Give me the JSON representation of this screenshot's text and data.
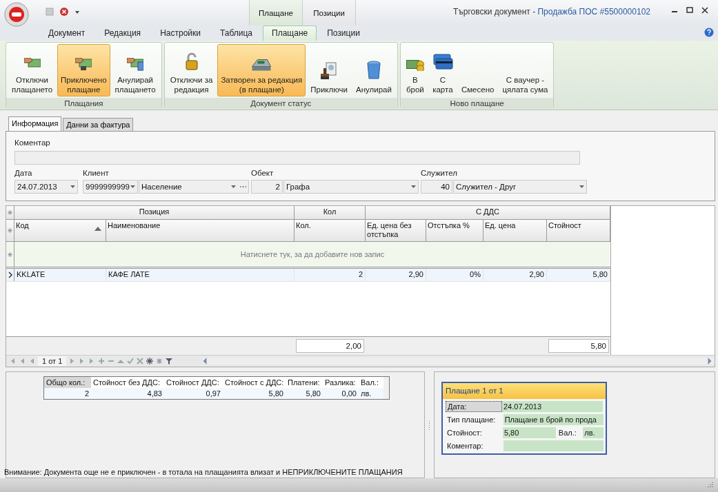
{
  "window": {
    "title": "Търговски документ - ",
    "document": "Продажба ПОС #5500000102",
    "context_tabs": [
      "Плащане",
      "Позиции"
    ]
  },
  "ribbon_tabs": [
    {
      "label": "Документ",
      "selected": false
    },
    {
      "label": "Редакция",
      "selected": false
    },
    {
      "label": "Настройки",
      "selected": false
    },
    {
      "label": "Таблица",
      "selected": false
    },
    {
      "label": "Плащане",
      "selected": true
    },
    {
      "label": "Позиции",
      "selected": false
    }
  ],
  "ribbon_groups": [
    {
      "title": "Плащания",
      "buttons": [
        {
          "lines": [
            "Отключи",
            "плащането"
          ],
          "selected": false
        },
        {
          "lines": [
            "Приключено",
            "плащане"
          ],
          "selected": true
        },
        {
          "lines": [
            "Анулирай",
            "плащането"
          ],
          "selected": false
        }
      ]
    },
    {
      "title": "Документ статус",
      "buttons": [
        {
          "lines": [
            "Отключи за",
            "редакция"
          ],
          "selected": false
        },
        {
          "lines": [
            "Затворен за редакция",
            "(в плащане)"
          ],
          "selected": true
        },
        {
          "lines": [
            "Приключи"
          ],
          "selected": false
        },
        {
          "lines": [
            "Анулирай"
          ],
          "selected": false
        }
      ]
    },
    {
      "title": "Ново плащане",
      "buttons": [
        {
          "lines": [
            "В",
            "брой"
          ],
          "selected": false
        },
        {
          "lines": [
            "С",
            "карта"
          ],
          "selected": false
        },
        {
          "lines": [
            "Смесено"
          ],
          "selected": false
        },
        {
          "lines": [
            "С ваучер -",
            "цялата сума"
          ],
          "selected": false
        }
      ]
    }
  ],
  "info_tabs": [
    {
      "label": "Информация",
      "selected": true
    },
    {
      "label": "Данни за фактура",
      "selected": false
    }
  ],
  "form": {
    "comment_label": "Коментар",
    "date_label": "Дата",
    "date": "24.07.2013",
    "client_label": "Клиент",
    "client_code": "9999999999",
    "client_name": "Население",
    "object_label": "Обект",
    "object_code": "2",
    "object_name": "Графа",
    "employee_label": "Служител",
    "employee_code": "40",
    "employee_name": "Служител - Друг"
  },
  "grid": {
    "bands": [
      "Позиция",
      "Кол",
      "С ДДС"
    ],
    "columns": [
      "Код",
      "Наименование",
      "Кол.",
      "Ед. цена без отстъпка",
      "Отстъпка %",
      "Ед. цена",
      "Стойност"
    ],
    "new_row_hint": "Натиснете тук, за да добавите нов запис",
    "rows": [
      {
        "selected": true,
        "cells": [
          "KKLATE",
          "КАФЕ ЛАТЕ",
          "2",
          "2,90",
          "0%",
          "2,90",
          "5,80"
        ]
      }
    ],
    "totals": [
      "2,00",
      "5,80"
    ],
    "page": "1 от 1"
  },
  "summary": {
    "headers": [
      "Общо кол.:",
      "Стойност без ДДС:",
      "Стойност ДДС:",
      "Стойност с ДДС:",
      "Платени:",
      "Разлика:",
      "Вал.:"
    ],
    "values": [
      "2",
      "4,83",
      "0,97",
      "5,80",
      "5,80",
      "0,00",
      "лв."
    ]
  },
  "warning": "Внимание: Документа още не е приключен - в тотала на плащанията влизат и НЕПРИКЛЮЧЕНИТЕ ПЛАЩАНИЯ",
  "payment": {
    "title": "Плащане 1 от 1",
    "date_label": "Дата:",
    "date": "24.07.2013",
    "type_label": "Тип плащане:",
    "type": "Плащане в брой по прода",
    "amount_label": "Стойност:",
    "amount": "5,80",
    "currency_label": "Вал.:",
    "currency": "лв.",
    "comment_label": "Коментар:"
  }
}
